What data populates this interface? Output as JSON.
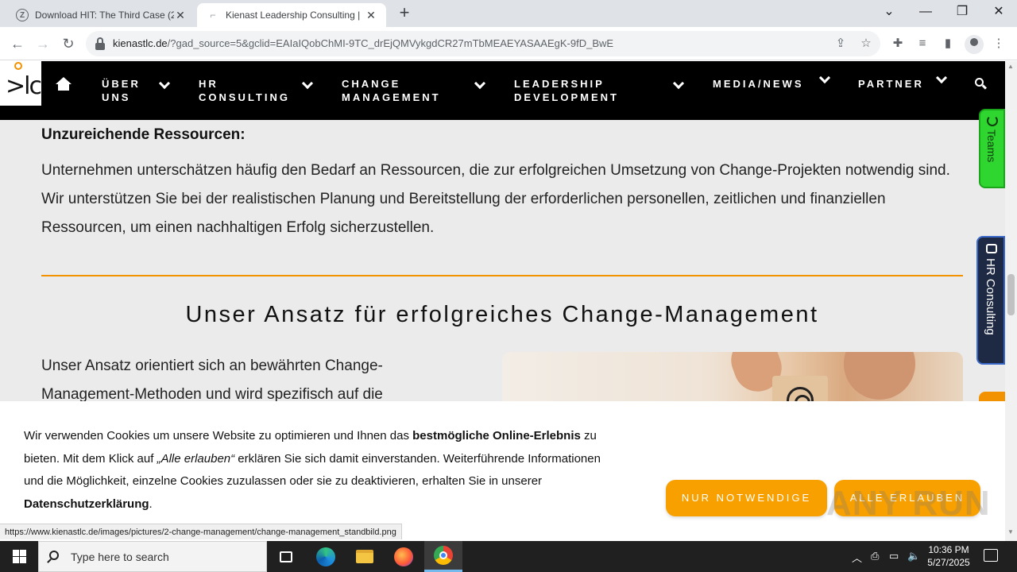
{
  "browser": {
    "tabs": [
      {
        "favicon": "Z",
        "title": "Download HIT: The Third Case (2",
        "active": false
      },
      {
        "favicon": "⌐",
        "title": "Kienast Leadership Consulting | ",
        "active": true
      }
    ],
    "new_tab": "+",
    "window_controls": {
      "dropdown": "⌄",
      "minimize": "—",
      "restore": "❐",
      "close": "✕"
    },
    "url_domain": "kienastlc.de",
    "url_path": "/?gad_source=5&gclid=EAIaIQobChMI-9TC_drEjQMVykgdCR27mTbMEAEYASAAEgK-9fD_BwE"
  },
  "site": {
    "nav": [
      {
        "line1": "ÜBER",
        "line2": "UNS"
      },
      {
        "line1": "HR",
        "line2": "CONSULTING"
      },
      {
        "line1": "CHANGE",
        "line2": "MANAGEMENT"
      },
      {
        "line1": "LEADERSHIP",
        "line2": "DEVELOPMENT"
      },
      {
        "line1": "MEDIA/NEWS",
        "line2": ""
      },
      {
        "line1": "PARTNER",
        "line2": ""
      }
    ],
    "logo_text": ">lc",
    "content_heading": "Unzureichende Ressourcen:",
    "content_para": "Unternehmen unterschätzen häufig den Bedarf an Ressourcen, die zur erfolgreichen Umsetzung von Change-Projekten notwendig sind. Wir unterstützen Sie bei der realistischen Planung und Bereitstellung der erforderlichen personellen, zeitlichen und finanziellen Ressourcen, um einen nachhaltigen Erfolg sicherzustellen.",
    "section_title": "Unser Ansatz für erfolgreiches Change-Management",
    "section_para": "Unser Ansatz orientiert sich an bewährten Change-Management-Methoden und wird spezifisch auf die",
    "side_tabs": {
      "teams": "Teams",
      "hr": "HR Consulting"
    },
    "accent_color": "#f39200"
  },
  "cookie": {
    "part1": "Wir verwenden Cookies um unsere Website zu optimieren und Ihnen das ",
    "bold1": "bestmögliche Online-Erlebnis",
    "part2": " zu bieten. Mit dem Klick auf ",
    "italic1": "„Alle erlauben“",
    "part3": " erklären Sie sich damit einverstanden. Weiterführende Informationen und die Möglichkeit, einzelne Cookies zuzulassen oder sie zu deaktivieren, erhalten Sie in unserer ",
    "bold2": "Datenschutzerklärung",
    "part4": ".",
    "btn_necessary": "NUR NOTWENDIGE",
    "btn_allow": "ALLE ERLAUBEN",
    "button_color": "#f7a000"
  },
  "status_url": "https://www.kienastlc.de/images/pictures/2-change-management/change-management_standbild.png",
  "watermark": "ANY RUN",
  "taskbar": {
    "search_placeholder": "Type here to search",
    "time": "10:36 PM",
    "date": "5/27/2025"
  }
}
